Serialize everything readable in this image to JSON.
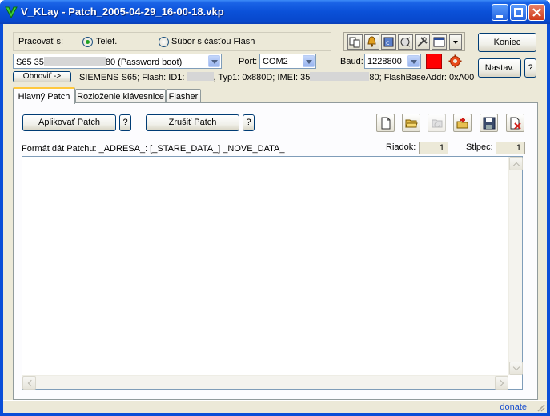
{
  "window": {
    "title": "V_KLay - Patch_2005-04-29_16-00-18.vkp"
  },
  "connection": {
    "work_with_label": "Pracovať s:",
    "radio_phone": "Telef.",
    "radio_file": "Súbor s časťou Flash",
    "selected": "phone"
  },
  "device": {
    "combo_prefix": "S65 35",
    "combo_suffix": "80 (Password boot)",
    "port_label": "Port:",
    "port_value": "COM2",
    "baud_label": "Baud:",
    "baud_value": "1228800",
    "indicator_color": "#ff0000"
  },
  "buttons": {
    "end": "Koniec",
    "settings": "Nastav.",
    "help": "?",
    "refresh": "Obnoviť ->",
    "apply_patch": "Aplikovať Patch",
    "cancel_patch": "Zrušiť Patch"
  },
  "info_line": {
    "part1": "SIEMENS S65; Flash: ID1: ",
    "part2": ", Typ1: 0x880D; IMEI: 35",
    "part3": "80; FlashBaseAddr: 0xA00"
  },
  "tabs": [
    {
      "label": "Hlavný Patch",
      "active": true
    },
    {
      "label": "Rozloženie klávesnice",
      "active": false
    },
    {
      "label": "Flasher",
      "active": false
    }
  ],
  "patch_panel": {
    "format_text": "Formát dát Patchu: _ADRESA_: [_STARE_DATA_] _NOVE_DATA_",
    "row_label": "Riadok:",
    "row_value": "1",
    "col_label": "Stĺpec:",
    "col_value": "1"
  },
  "statusbar": {
    "donate": "donate"
  },
  "icons": {
    "toolbar": [
      "copy-icon",
      "bell-icon",
      "chip-icon",
      "speaker-icon",
      "tools-icon",
      "window-icon",
      "dropdown-arrow-icon"
    ],
    "panel": [
      "new-file-icon",
      "open-folder-icon",
      "reload-icon",
      "add-patch-icon",
      "save-icon",
      "delete-file-icon"
    ],
    "indicator_settings": "gear-icon"
  },
  "colors": {
    "titlebar": "#0a50d8",
    "face": "#ece9d8",
    "tab_highlight": "#ffc83c",
    "link": "#1a4fcf"
  }
}
